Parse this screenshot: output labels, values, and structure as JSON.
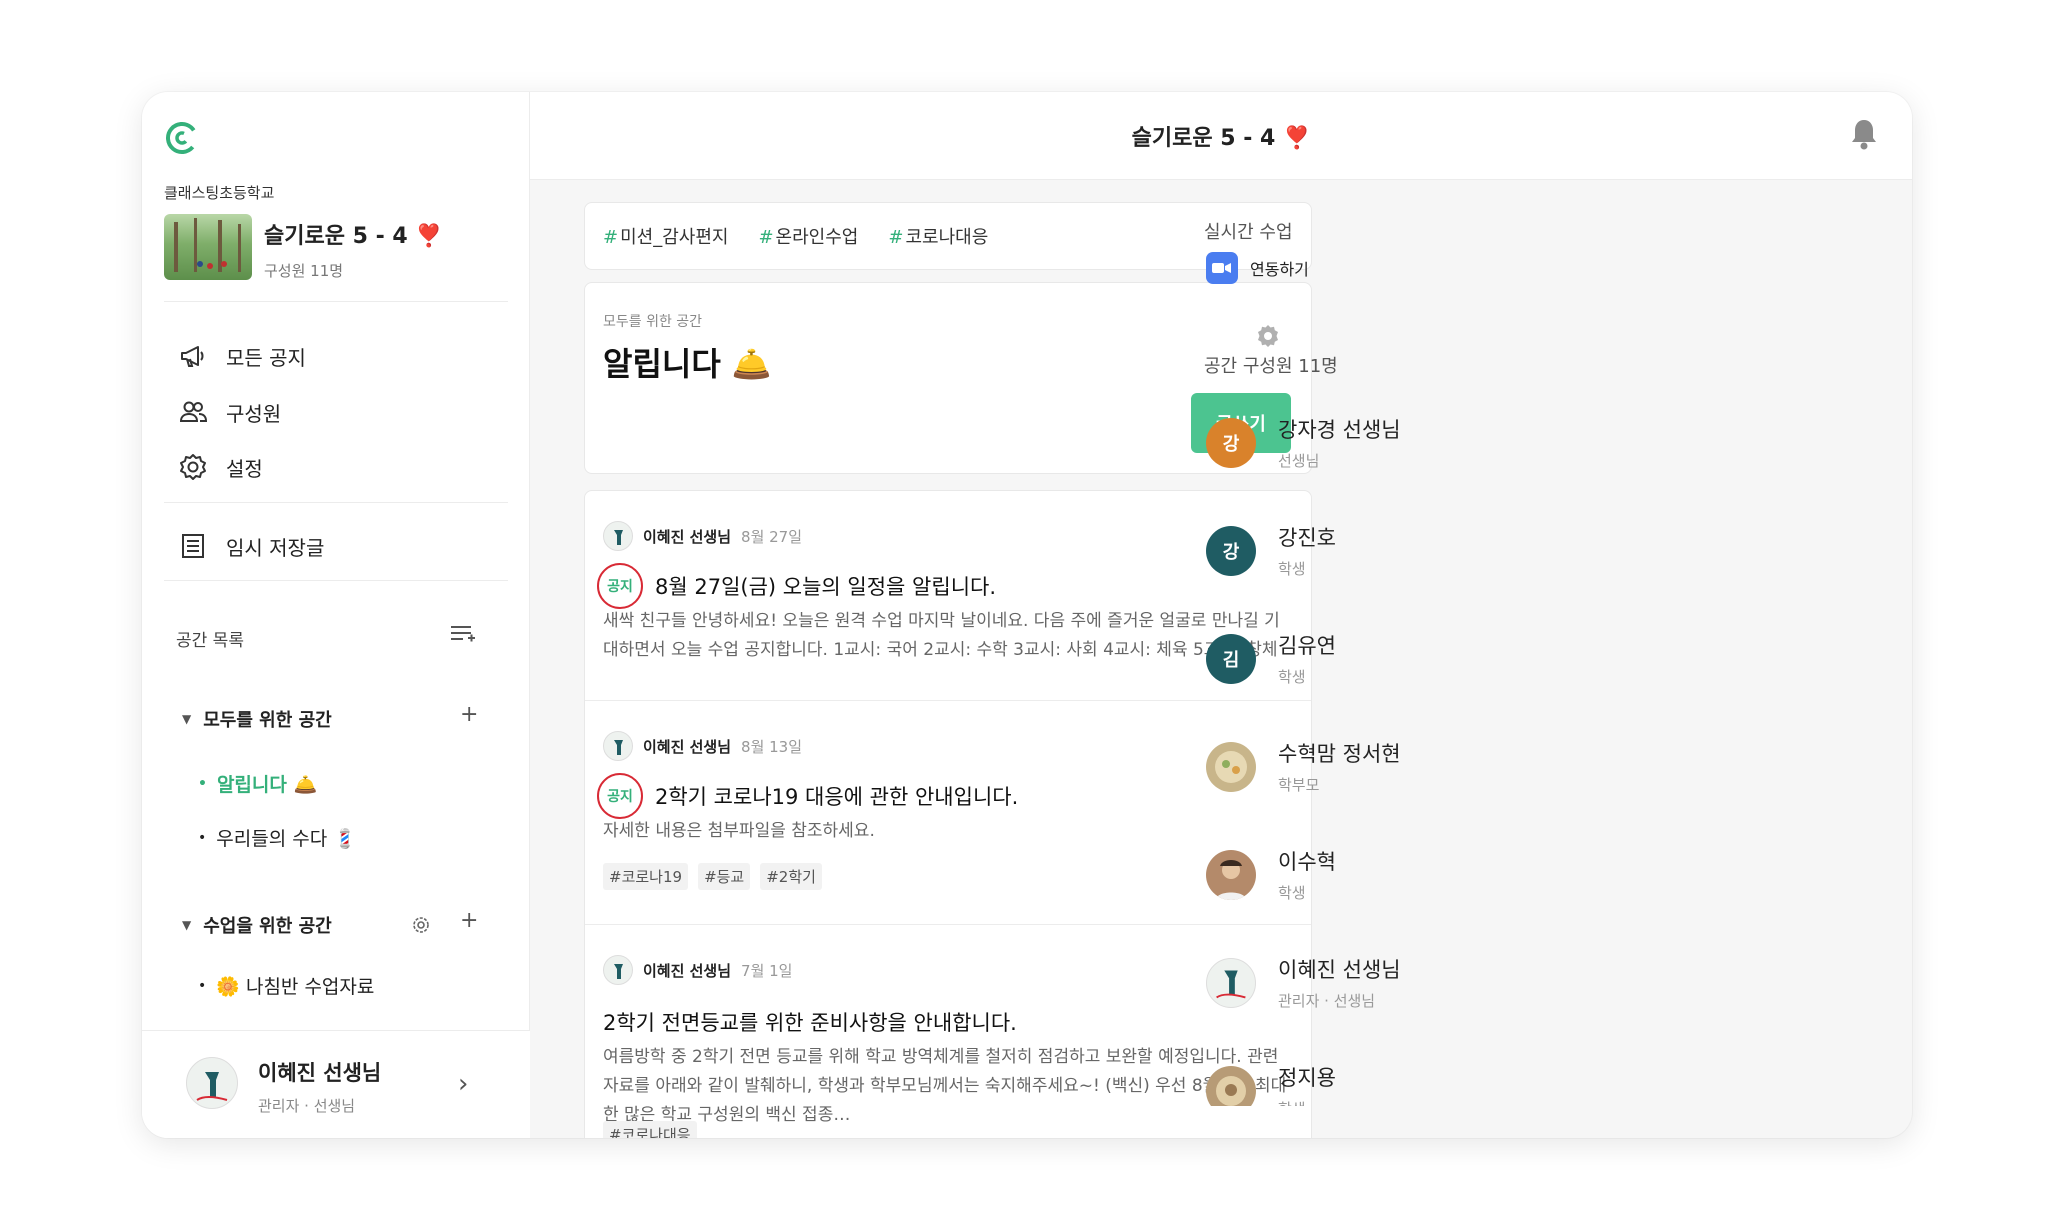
{
  "sidebar": {
    "school": "클래스팅초등학교",
    "class_name": "슬기로운 5 - 4",
    "class_emoji": "❣️",
    "members": "구성원 11명",
    "nav": [
      {
        "label": "모든 공지"
      },
      {
        "label": "구성원"
      },
      {
        "label": "설정"
      }
    ],
    "drafts": "임시 저장글",
    "space_list_title": "공간 목록",
    "group1": {
      "label": "모두를 위한 공간",
      "items": [
        "알립니다 🛎️",
        "우리들의 수다 💈"
      ]
    },
    "group2": {
      "label": "수업을 위한 공간",
      "items": [
        "🌼 나침반 수업자료"
      ]
    },
    "profile": {
      "name": "이혜진 선생님",
      "role": "관리자 · 선생님"
    }
  },
  "topbar": {
    "title": "슬기로운 5 - 4 ❣️"
  },
  "hashtags": [
    "미션_감사편지",
    "온라인수업",
    "코로나대응"
  ],
  "notice": {
    "subtitle": "모두를 위한 공간",
    "title": "알립니다 🛎️",
    "write_button": "글쓰기"
  },
  "posts": [
    {
      "author": "이혜진 선생님",
      "date": "8월 27일",
      "badge": "공지",
      "title": "8월 27일(금) 오늘의 일정을 알립니다.",
      "body": "새싹 친구들 안녕하세요! 오늘은 원격 수업 마지막 날이네요. 다음 주에 즐거운 얼굴로 만나길 기대하면서 오늘 수업 공지합니다. 1교시: 국어 2교시: 수학 3교시: 사회 4교시: 체육 5교시: 창체",
      "tags": []
    },
    {
      "author": "이혜진 선생님",
      "date": "8월 13일",
      "badge": "공지",
      "title": "2학기 코로나19 대응에 관한 안내입니다.",
      "body": "자세한 내용은 첨부파일을 참조하세요.",
      "tags": [
        "#코로나19",
        "#등교",
        "#2학기"
      ]
    },
    {
      "author": "이혜진 선생님",
      "date": "7월 1일",
      "badge": "",
      "title": "2학기 전면등교를 위한 준비사항을 안내합니다.",
      "body": "여름방학 중 2학기 전면 등교를 위해 학교 방역체계를 철저히 점검하고 보완할 예정입니다. 관련 자료를 아래와 같이 발췌하니, 학생과 학부모님께서는 숙지해주세요~! (백신) 우선 8월까지 최대한 많은 학교 구성원의 백신 접종…",
      "tags": [
        "#코로나대응"
      ]
    }
  ],
  "right": {
    "live_title": "실시간 수업",
    "zoom_label": "연동하기",
    "members_title": "공간 구성원 11명",
    "members": [
      {
        "name": "강자경 선생님",
        "role": "선생님",
        "initial": "강",
        "color": "#d9822b"
      },
      {
        "name": "강진호",
        "role": "학생",
        "initial": "강",
        "color": "#1f5c63"
      },
      {
        "name": "김유연",
        "role": "학생",
        "initial": "김",
        "color": "#1f5c63"
      },
      {
        "name": "수혁맘 정서현",
        "role": "학부모",
        "initial": "",
        "color": "#c8b58a"
      },
      {
        "name": "이수혁",
        "role": "학생",
        "initial": "",
        "color": "#b48a6a"
      },
      {
        "name": "이혜진 선생님",
        "role": "관리자 · 선생님",
        "initial": "",
        "color": "#eef2ef"
      },
      {
        "name": "정지용",
        "role": "학생",
        "initial": "",
        "color": "#b79b76"
      }
    ]
  },
  "colors": {
    "accent": "#34b07a",
    "button": "#4cc490",
    "badge_ring": "#d82a35",
    "zoom": "#4a7df0"
  }
}
